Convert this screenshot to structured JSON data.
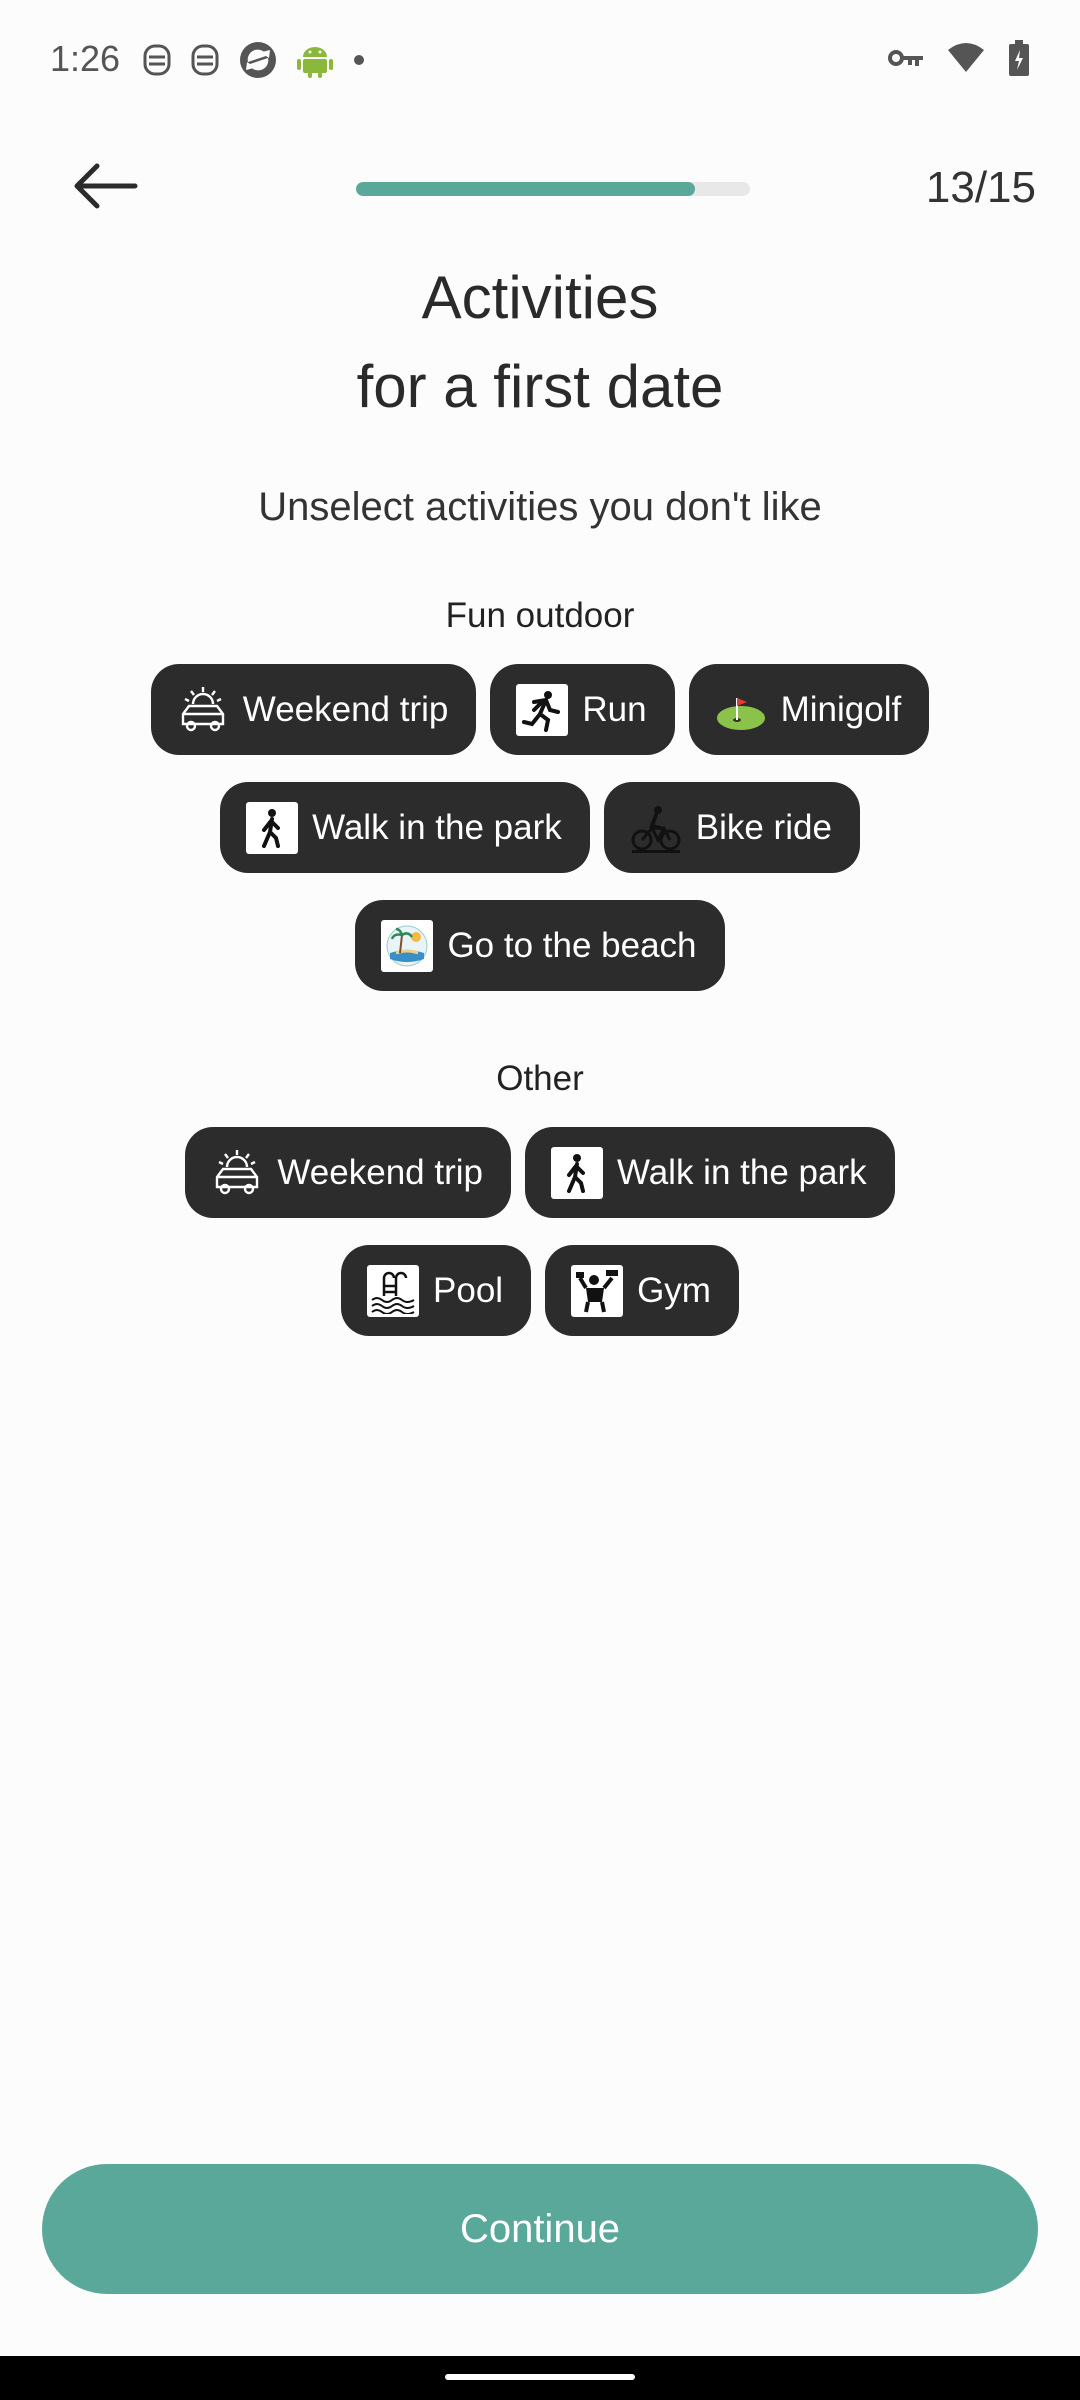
{
  "status_bar": {
    "time": "1:26",
    "left_icons": [
      "notification-icon",
      "notification-icon",
      "sync-icon",
      "android-icon",
      "dot-icon"
    ],
    "right_icons": [
      "key-icon",
      "wifi-icon",
      "battery-icon"
    ]
  },
  "header": {
    "back_icon": "arrow-left-icon",
    "progress": 0.86,
    "step_counter": "13/15"
  },
  "title_line1": "Activities",
  "title_line2": "for a first date",
  "subtitle": "Unselect activities you don't like",
  "sections": [
    {
      "label": "Fun outdoor",
      "chips": [
        {
          "label": "Weekend trip",
          "icon": "car-icon"
        },
        {
          "label": "Run",
          "icon": "runner-icon"
        },
        {
          "label": "Minigolf",
          "icon": "golf-icon"
        },
        {
          "label": "Walk in the park",
          "icon": "walker-icon"
        },
        {
          "label": "Bike ride",
          "icon": "bike-icon"
        },
        {
          "label": "Go to the beach",
          "icon": "beach-icon"
        }
      ]
    },
    {
      "label": "Other",
      "chips": [
        {
          "label": "Weekend trip",
          "icon": "car-icon"
        },
        {
          "label": "Walk in the park",
          "icon": "walker-icon"
        },
        {
          "label": "Pool",
          "icon": "pool-icon"
        },
        {
          "label": "Gym",
          "icon": "gym-icon"
        }
      ]
    }
  ],
  "continue_label": "Continue",
  "colors": {
    "accent": "#5aa89a",
    "chip_bg": "#2c2c2c",
    "background": "#fcfcfc"
  }
}
